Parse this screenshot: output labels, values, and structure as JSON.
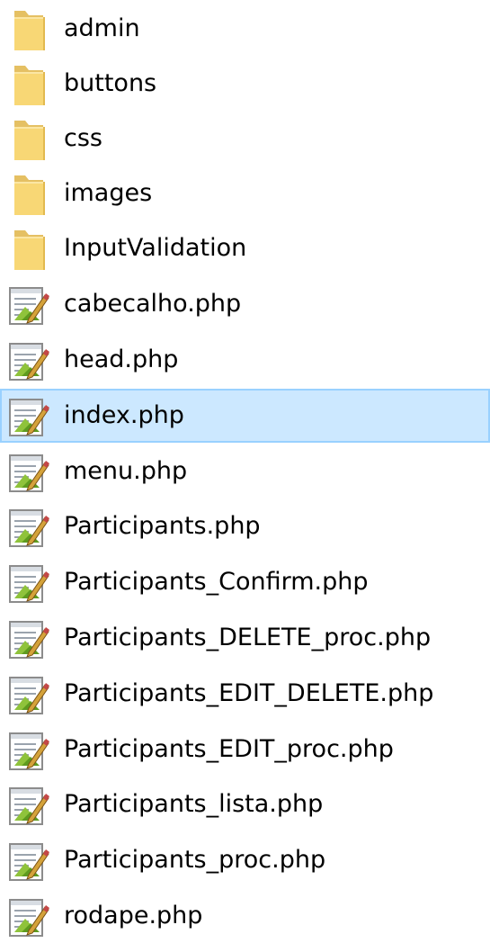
{
  "colors": {
    "folder_fill": "#f8d775",
    "folder_shade": "#e5c063",
    "selection_fill": "#cce8ff",
    "selection_border": "#99d1ff"
  },
  "items": [
    {
      "label": "admin",
      "kind": "folder",
      "icon": "folder-icon",
      "selected": false
    },
    {
      "label": "buttons",
      "kind": "folder",
      "icon": "folder-icon",
      "selected": false
    },
    {
      "label": "css",
      "kind": "folder",
      "icon": "folder-icon",
      "selected": false
    },
    {
      "label": "images",
      "kind": "folder",
      "icon": "folder-icon",
      "selected": false
    },
    {
      "label": "InputValidation",
      "kind": "folder",
      "icon": "folder-icon",
      "selected": false
    },
    {
      "label": "cabecalho.php",
      "kind": "file",
      "icon": "php-file-icon",
      "selected": false
    },
    {
      "label": "head.php",
      "kind": "file",
      "icon": "php-file-icon",
      "selected": false
    },
    {
      "label": "index.php",
      "kind": "file",
      "icon": "php-file-icon",
      "selected": true
    },
    {
      "label": "menu.php",
      "kind": "file",
      "icon": "php-file-icon",
      "selected": false
    },
    {
      "label": "Participants.php",
      "kind": "file",
      "icon": "php-file-icon",
      "selected": false
    },
    {
      "label": "Participants_Confirm.php",
      "kind": "file",
      "icon": "php-file-icon",
      "selected": false
    },
    {
      "label": "Participants_DELETE_proc.php",
      "kind": "file",
      "icon": "php-file-icon",
      "selected": false
    },
    {
      "label": "Participants_EDIT_DELETE.php",
      "kind": "file",
      "icon": "php-file-icon",
      "selected": false
    },
    {
      "label": "Participants_EDIT_proc.php",
      "kind": "file",
      "icon": "php-file-icon",
      "selected": false
    },
    {
      "label": "Participants_lista.php",
      "kind": "file",
      "icon": "php-file-icon",
      "selected": false
    },
    {
      "label": "Participants_proc.php",
      "kind": "file",
      "icon": "php-file-icon",
      "selected": false
    },
    {
      "label": "rodape.php",
      "kind": "file",
      "icon": "php-file-icon",
      "selected": false
    }
  ]
}
